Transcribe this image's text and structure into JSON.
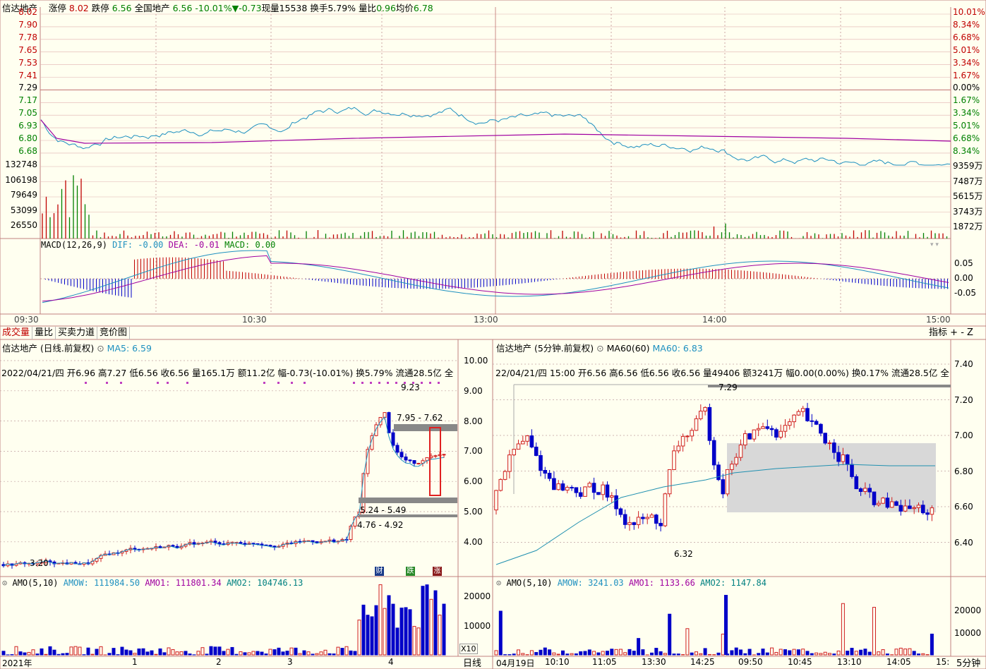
{
  "intraday": {
    "name": "信达地产",
    "limit_up_label": "涨停",
    "limit_up_value": "8.02",
    "limit_down_label": "跌停",
    "limit_down_value": "6.56",
    "market_label": "全国地产",
    "price": "6.56",
    "pct_change": "-10.01%",
    "change": "▼-0.73",
    "volume_label": "现量",
    "volume": "15538",
    "turnover_label": "换手",
    "turnover": "5.79%",
    "ratio_label": "量比",
    "ratio": "0.96",
    "avg_label": "均价",
    "avg": "6.78",
    "y_left": [
      "8.02",
      "7.90",
      "7.78",
      "7.65",
      "7.53",
      "7.41",
      "7.29",
      "7.17",
      "7.05",
      "6.93",
      "6.80",
      "6.68",
      "132748",
      "106198",
      "79649",
      "53099",
      "26550"
    ],
    "y_right": [
      "10.01%",
      "8.34%",
      "6.68%",
      "5.01%",
      "3.34%",
      "1.67%",
      "0.00%",
      "1.67%",
      "3.34%",
      "5.01%",
      "6.68%",
      "8.34%",
      "9359万",
      "7487万",
      "5615万",
      "3743万",
      "1872万"
    ],
    "macd_label": "MACD(12,26,9)",
    "dif": "DIF: -0.00",
    "dea": "DEA: -0.01",
    "macd": "MACD: 0.00",
    "macd_y": [
      "0.05",
      "0.00",
      "-0.05"
    ],
    "time_axis": [
      "09:30",
      "10:30",
      "13:00",
      "14:00",
      "15:00"
    ]
  },
  "tabs": [
    "成交量",
    "量比",
    "买卖力道",
    "竞价图"
  ],
  "tab_right": [
    "指标",
    "+",
    "-",
    "Z"
  ],
  "daily": {
    "title": "信达地产 (日线.前复权)",
    "ma_label": "MA5: 6.59",
    "info": "2022/04/21/四 开6.96 高7.27 低6.56 收6.56 量165.1万 额11.2亿 幅-0.73(-10.01%) 换5.79% 流通28.5亿 全",
    "y_axis": [
      "10.00",
      "9.00",
      "8.00",
      "7.00",
      "6.00",
      "5.00",
      "4.00"
    ],
    "annotations": [
      "9.23",
      "7.95 - 7.62",
      "5.24 - 5.49",
      "4.76 - 4.92",
      "3.20"
    ],
    "badges": [
      "财",
      "跌",
      "涨"
    ],
    "amo_label": "AMO(5,10)",
    "amow": "AMOW: 111984.50",
    "amo1": "AMO1: 111801.34",
    "amo2": "AMO2: 104746.13",
    "amo_y": [
      "20000",
      "10000"
    ],
    "x10": "X10",
    "x_axis": [
      "2021年",
      "1",
      "2",
      "3",
      "4"
    ],
    "period": "日线"
  },
  "min5": {
    "title": "信达地产 (5分钟.前复权)",
    "ma_label": "MA60(60)",
    "ma_value": "MA60: 6.83",
    "info": "22/04/21/四 15:00 开6.56 高6.56 低6.56 收6.56 量49406 额3241万 幅0.00(0.00%) 换0.17% 流通28.5亿 全",
    "y_axis": [
      "7.40",
      "7.20",
      "7.00",
      "6.80",
      "6.60",
      "6.40"
    ],
    "annotations": [
      "7.29",
      "6.32"
    ],
    "amo_label": "AMO(5,10)",
    "amow": "AMOW: 3241.03",
    "amo1": "AMO1: 1133.66",
    "amo2": "AMO2: 1147.84",
    "amo_y": [
      "20000",
      "10000"
    ],
    "x_axis": [
      "04月19日",
      "10:10",
      "11:05",
      "13:30",
      "14:25",
      "09:50",
      "10:45",
      "13:10",
      "14:05",
      "15:"
    ],
    "period": "5分钟"
  },
  "colors": {
    "up": "#d02020",
    "down": "#0000c8",
    "price": "#1e90c0",
    "avg": "#a000a0",
    "grid": "#d0a0a0",
    "bg": "#fffff0"
  }
}
